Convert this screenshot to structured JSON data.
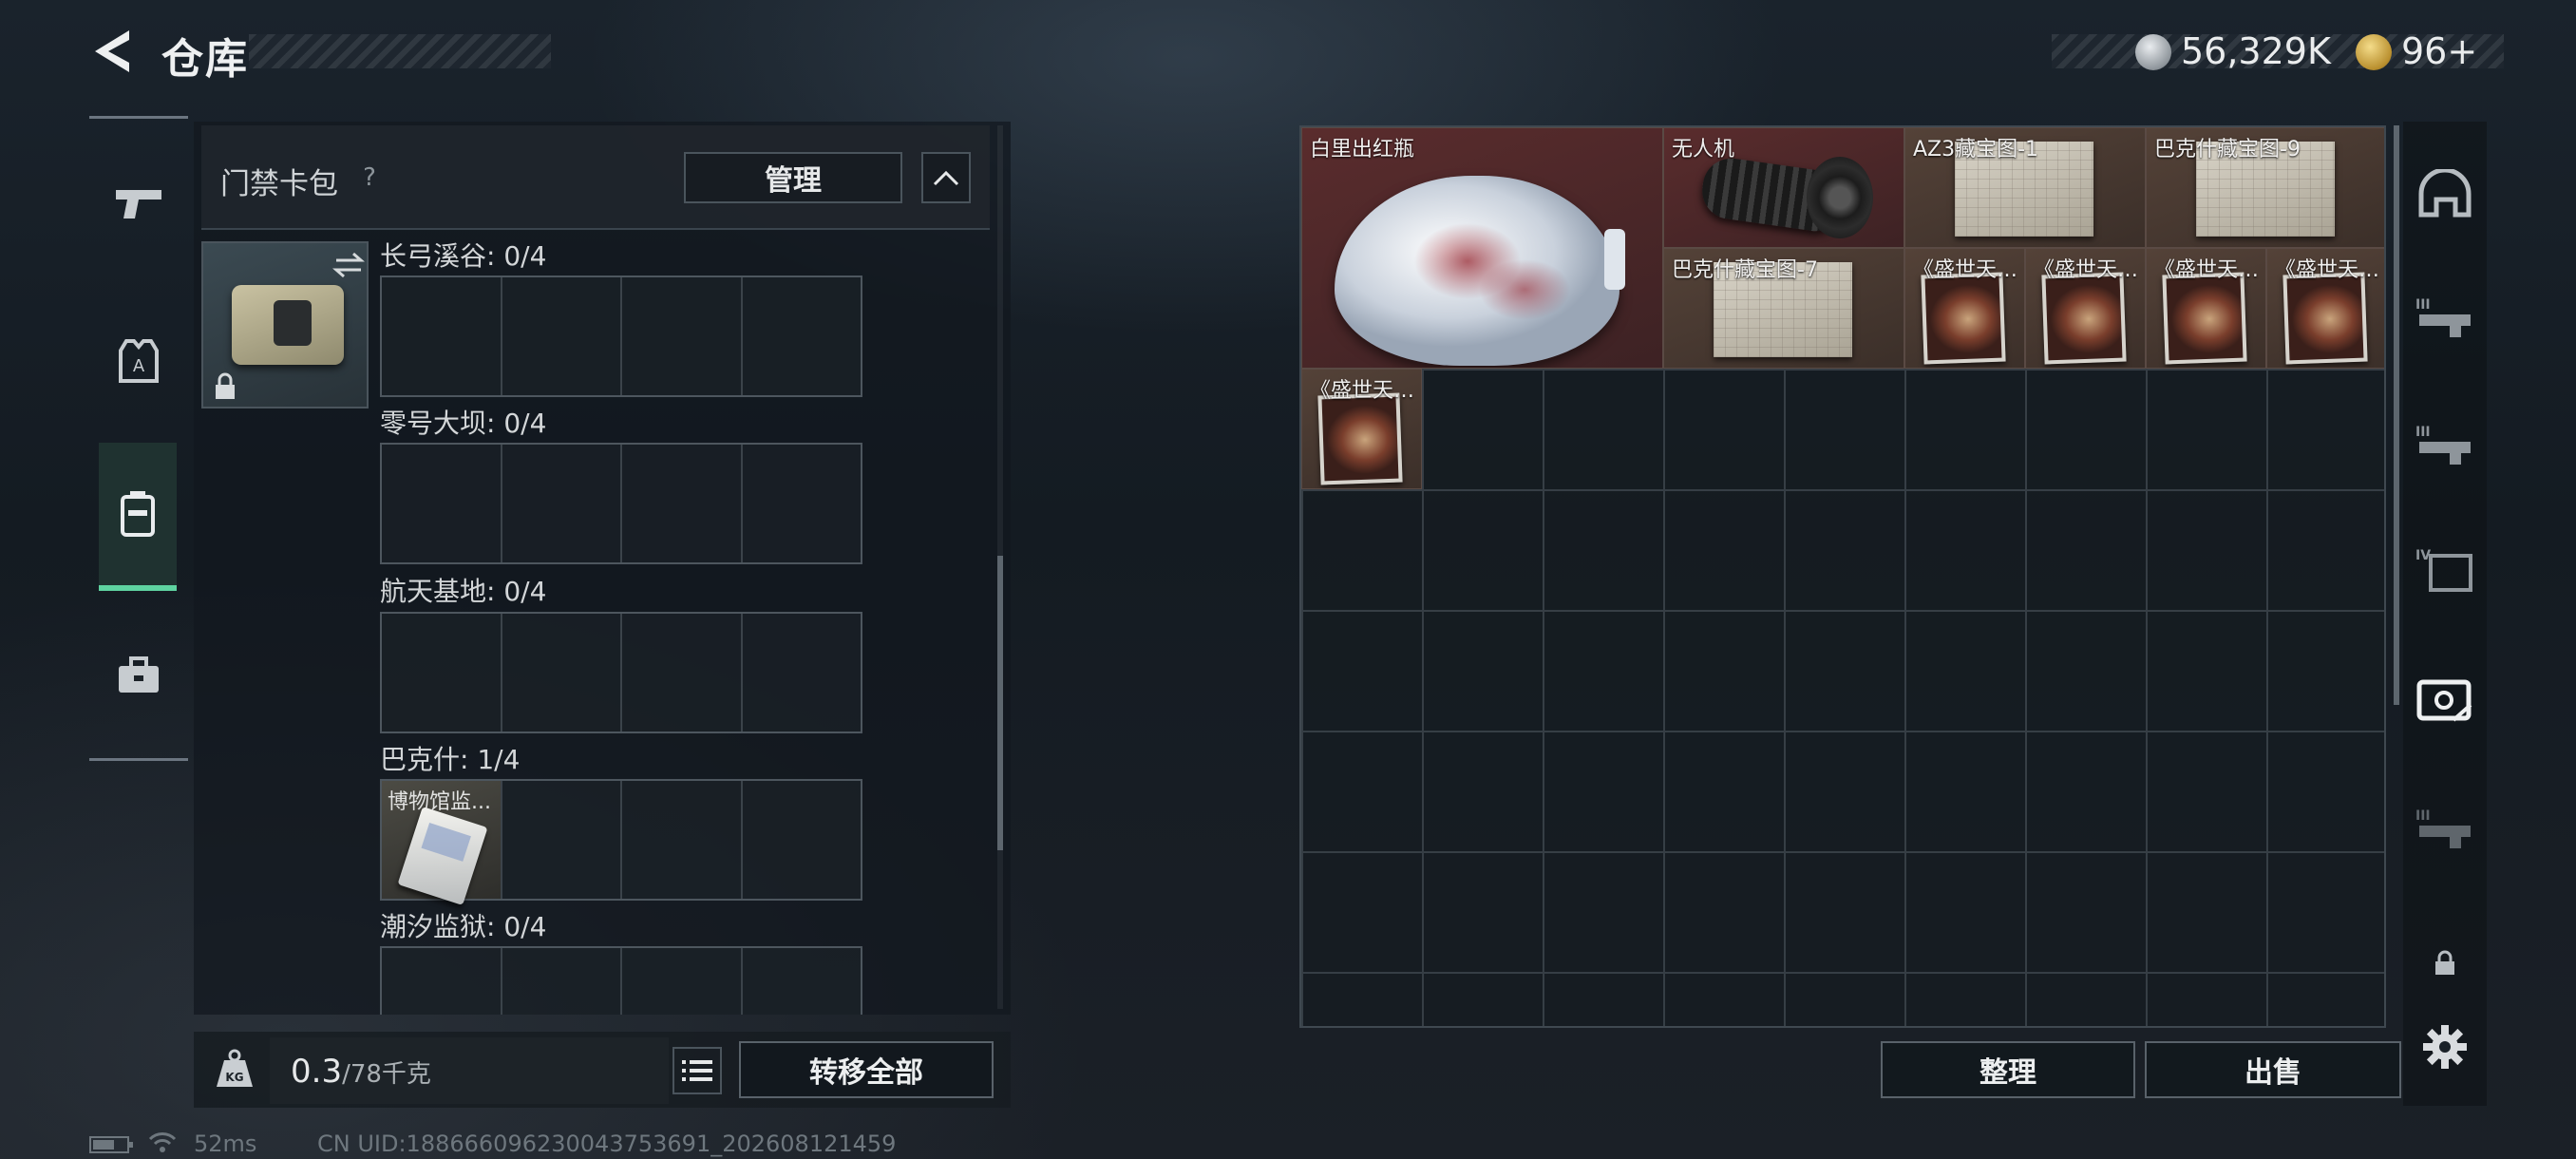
{
  "header": {
    "title": "仓库",
    "currency_silver": "56,329K",
    "currency_gold": "96+"
  },
  "left_rail": {
    "items": [
      {
        "icon": "pistol-icon"
      },
      {
        "icon": "vest-icon"
      },
      {
        "icon": "backpack-icon",
        "active": true
      },
      {
        "icon": "case-icon"
      }
    ]
  },
  "keycard": {
    "title": "门禁卡包",
    "help": "?",
    "manage_label": "管理",
    "regions": [
      {
        "label": "长弓溪谷: 0/4",
        "items": []
      },
      {
        "label": "零号大坝: 0/4",
        "items": []
      },
      {
        "label": "航天基地: 0/4",
        "items": []
      },
      {
        "label": "巴克什: 1/4",
        "items": [
          {
            "name": "博物馆监..."
          }
        ]
      },
      {
        "label": "潮汐监狱: 0/4",
        "items": []
      }
    ]
  },
  "weight": {
    "value": "0.3",
    "unit": "/78千克"
  },
  "left_actions": {
    "transfer_all": "转移全部"
  },
  "status": {
    "ping": "52ms",
    "uid": "CN UID:188666096230043753691_202608121459"
  },
  "stash": {
    "items": [
      {
        "name": "白里出红瓶",
        "color": "#5a2c2d"
      },
      {
        "name": "无人机",
        "color": "#5a2c2d"
      },
      {
        "name": "AZ3藏宝图-1",
        "color": "#544238"
      },
      {
        "name": "巴克什藏宝图-9",
        "color": "#544238"
      },
      {
        "name": "巴克什藏宝图-7",
        "color": "#544238"
      },
      {
        "name": "《盛世天…",
        "color": "#544238"
      },
      {
        "name": "《盛世天…",
        "color": "#544238"
      },
      {
        "name": "《盛世天…",
        "color": "#544238"
      },
      {
        "name": "《盛世天…",
        "color": "#544238"
      },
      {
        "name": "《盛世天…",
        "color": "#544238"
      }
    ],
    "sort_label": "整理",
    "sell_label": "出售"
  },
  "right_rail": {
    "items": [
      {
        "icon": "helmet-icon"
      },
      {
        "icon": "rifle-slot-iii-icon"
      },
      {
        "icon": "rifle-slot-iii-icon"
      },
      {
        "icon": "armor-slot-iv-icon"
      },
      {
        "icon": "stash-active-icon",
        "active": true
      },
      {
        "icon": "rifle-slot-iii-icon"
      },
      {
        "icon": "lock-icon"
      },
      {
        "icon": "gear-icon"
      }
    ]
  }
}
